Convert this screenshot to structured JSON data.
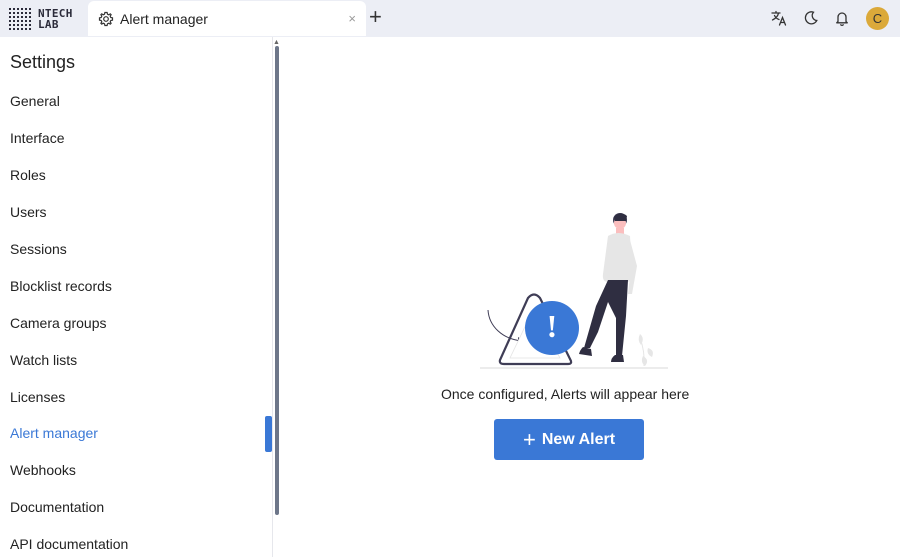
{
  "header": {
    "logo_line1": "NTECH",
    "logo_line2": "LAB",
    "tab_title": "Alert manager",
    "tab_icon": "gear-icon",
    "tab_close": "×",
    "tab_add": "+",
    "icons": [
      "translate-icon",
      "moon-icon",
      "bell-icon"
    ],
    "avatar_letter": "C",
    "avatar_color": "#dba93a"
  },
  "sidebar": {
    "title": "Settings",
    "items": [
      {
        "label": "General"
      },
      {
        "label": "Interface"
      },
      {
        "label": "Roles"
      },
      {
        "label": "Users"
      },
      {
        "label": "Sessions"
      },
      {
        "label": "Blocklist records"
      },
      {
        "label": "Camera groups"
      },
      {
        "label": "Watch lists"
      },
      {
        "label": "Licenses"
      },
      {
        "label": "Alert manager",
        "active": true
      },
      {
        "label": "Webhooks"
      },
      {
        "label": "Documentation"
      },
      {
        "label": "API documentation"
      }
    ]
  },
  "main": {
    "empty_message": "Once configured, Alerts will appear here",
    "new_alert_label": "New Alert",
    "new_alert_icon": "plus-icon",
    "illustration": "empty-alerts-illustration",
    "alert_symbol": "!"
  },
  "colors": {
    "accent": "#3a78d6",
    "topbar_bg": "#eceef5"
  }
}
